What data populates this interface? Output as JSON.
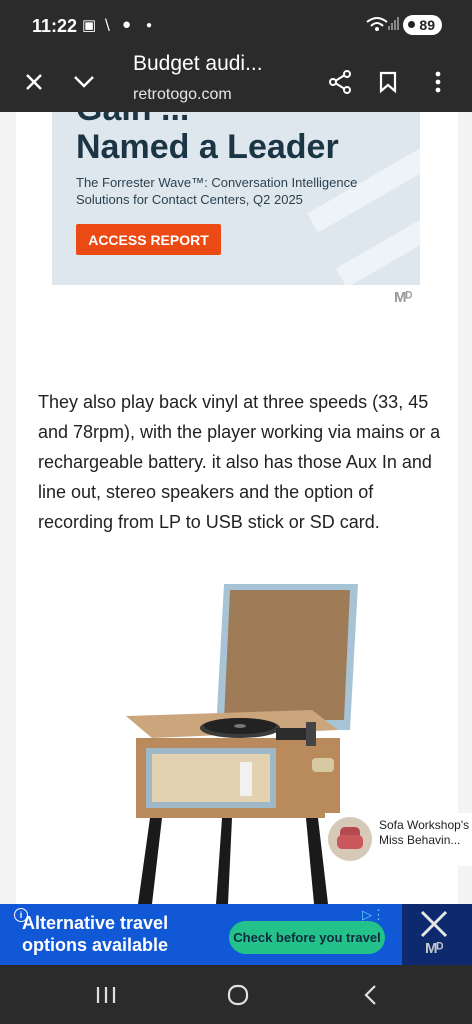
{
  "status_bar": {
    "time": "11:22",
    "icons": [
      "screenshot-icon",
      "call-icon",
      "soccer-ball-icon",
      "dot-icon"
    ],
    "battery": "89"
  },
  "toolbar": {
    "title": "Budget audi...",
    "url": "retrotogo.com",
    "icons": [
      "close-icon",
      "chevron-down-icon",
      "share-icon",
      "bookmark-icon",
      "more-vert-icon"
    ]
  },
  "top_ad": {
    "cut_heading": "Gain ...",
    "heading": "Named a Leader",
    "subtitle": "The Forrester Wave™: Conversation Intelligence Solutions for Contact Centers, Q2 2025",
    "cta": "ACCESS REPORT",
    "logo": "Mᴰ"
  },
  "article": {
    "paragraph": "They also play back vinyl at three speeds (33, 45 and 78rpm), with the player working via mains or a rechargeable battery. it also has those Aux In and line out, stereo speakers and the option of recording from LP to USB stick or SD card."
  },
  "recommendation": {
    "title": "Sofa Workshop's Miss Behavin..."
  },
  "bottom_ad": {
    "text": "Alternative travel options available",
    "cta": "Check before you travel",
    "logo": "Mᴰ",
    "accent": "#1158d6"
  },
  "nav_bar": {
    "icons": [
      "recents-icon",
      "home-icon",
      "back-icon"
    ]
  }
}
